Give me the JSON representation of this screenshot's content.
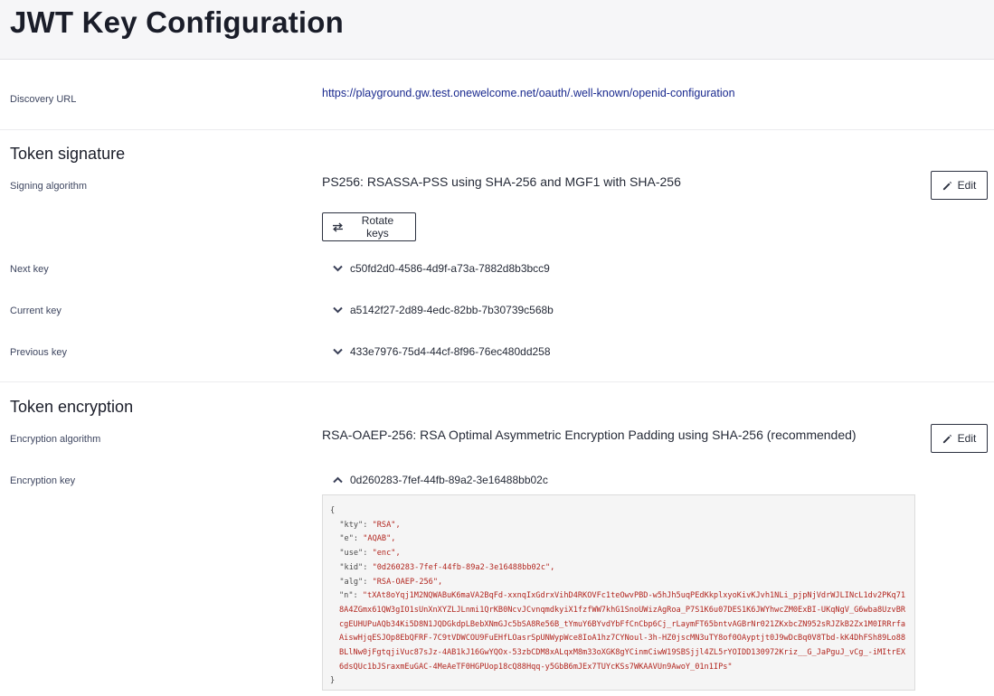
{
  "page": {
    "title": "JWT Key Configuration"
  },
  "discovery": {
    "label": "Discovery URL",
    "url": "https://playground.gw.test.onewelcome.net/oauth/.well-known/openid-configuration"
  },
  "signature": {
    "title": "Token signature",
    "algorithm_label": "Signing algorithm",
    "algorithm_value": "PS256: RSASSA-PSS using SHA-256 and MGF1 with SHA-256",
    "edit_label": "Edit",
    "rotate_label": "Rotate keys",
    "keys": [
      {
        "label": "Next key",
        "id": "c50fd2d0-4586-4d9f-a73a-7882d8b3bcc9",
        "icon": "chevron-down-icon"
      },
      {
        "label": "Current key",
        "id": "a5142f27-2d89-4edc-82bb-7b30739c568b",
        "icon": "chevron-down-icon"
      },
      {
        "label": "Previous key",
        "id": "433e7976-75d4-44cf-8f96-76ec480dd258",
        "icon": "chevron-down-icon"
      }
    ]
  },
  "encryption": {
    "title": "Token encryption",
    "algorithm_label": "Encryption algorithm",
    "algorithm_value": "RSA-OAEP-256: RSA Optimal Asymmetric Encryption Padding using SHA-256 (recommended)",
    "edit_label": "Edit",
    "key_label": "Encryption key",
    "key_id": "0d260283-7fef-44fb-89a2-3e16488bb02c",
    "key_icon": "chevron-up-icon",
    "jwk": {
      "open": "{",
      "close": "}",
      "kty_key": "\"kty\": ",
      "kty": "\"RSA\",",
      "e_key": "\"e\": ",
      "e": "\"AQAB\",",
      "use_key": "\"use\": ",
      "use": "\"enc\",",
      "kid_key": "\"kid\": ",
      "kid": "\"0d260283-7fef-44fb-89a2-3e16488bb02c\",",
      "alg_key": "\"alg\": ",
      "alg": "\"RSA-OAEP-256\",",
      "n_key": "\"n\": ",
      "n": "\"tXAt8oYqj1M2NQWABuK6maVA2BqFd-xxnqIxGdrxVihD4RKOVFc1teOwvPBD-w5hJh5uqPEdKkplxyoKivKJvh1NLi_pjpNjVdrWJLINcL1dv2PKq718A4ZGmx61QW3gIO1sUnXnXYZLJLnmi1QrKB0NcvJCvnqmdkyiX1fzfWW7khG1SnoUWizAgRoa_P7S1K6u07DES1K6JWYhwcZM0ExBI-UKqNgV_G6wba8UzvBRcgEUHUPuAQb34Ki5D8N1JQDGkdpLBebXNmGJc5bSA8Re56B_tYmuY6BYvdYbFfCnCbp6Cj_rLaymFT65bntvAGBrNr021ZKxbcZN952sRJZkB2Zx1M0IRRrfaAiswHjqESJOp8EbQFRF-7C9tVDWCOU9FuEHfLOasrSpUNWypWce8IoA1hz7CYNoul-3h-HZ0jscMN3uTY8of0OAyptjt0J9wDcBq0V8Tbd-kK4DhFSh89Lo88BLlNw0jFgtqjiVuc87sJz-4AB1kJ16GwYQOx-53zbCDM8xALqxM8m33oXGK8gYCinmCiwW19SBSjjl4ZL5rYOIDD130972Kriz__G_JaPguJ_vCg_-iMItrEX6dsQUc1bJSraxmEuGAC-4MeAeTF0HGPUop18cQ88Hqq-y5GbB6mJEx7TUYcKSs7WKAAVUn9AwoY_01n1IPs\""
    }
  },
  "colors": {
    "link": "#1a2a8f",
    "json_string": "#b2261f",
    "header_bg": "#f6f6f8"
  }
}
